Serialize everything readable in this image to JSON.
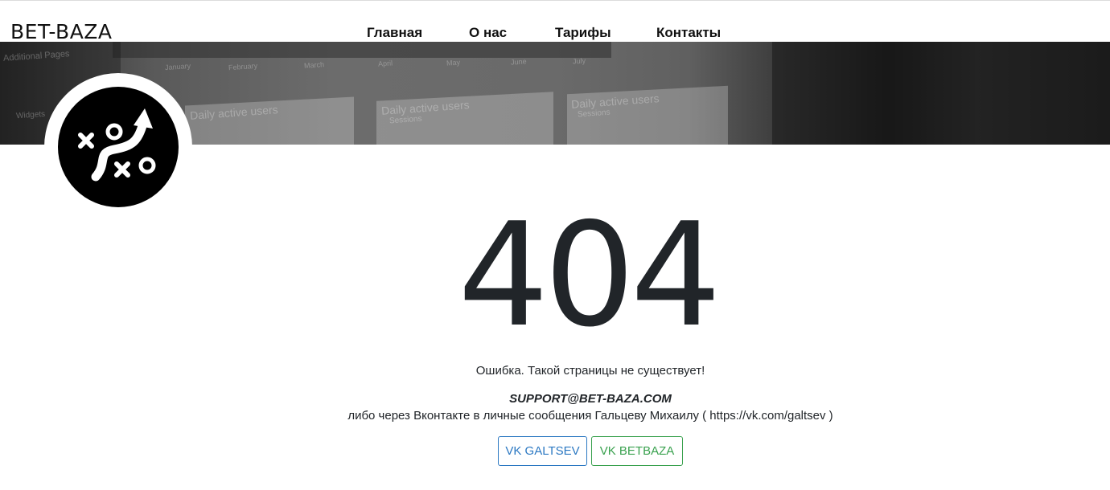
{
  "header": {
    "brand": "BET-BAZA",
    "nav": [
      {
        "label": "Главная"
      },
      {
        "label": "О нас"
      },
      {
        "label": "Тарифы"
      },
      {
        "label": "Контакты"
      }
    ]
  },
  "banner": {
    "texts": [
      "Additional Pages",
      "January",
      "February",
      "March",
      "April",
      "May",
      "June",
      "July",
      "Daily active users",
      "Daily active users",
      "Daily active users",
      "Sessions",
      "Sessions",
      "Widgets"
    ]
  },
  "logo": {
    "icon": "strategy-play-icon",
    "colors": {
      "background": "#000000",
      "foreground": "#ffffff"
    }
  },
  "error": {
    "code": "404",
    "message": "Ошибка. Такой страницы не существует!",
    "email": "SUPPORT@BET-BAZA.COM",
    "vk_note": "либо через Вконтакте в личные сообщения Гальцеву Михаилу ( https://vk.com/galtsev )"
  },
  "buttons": {
    "vk_galtsev": "VK GALTSEV",
    "vk_betbaza": "VK BETBAZA"
  },
  "colors": {
    "text": "#212529",
    "button_blue": "#2b78c2",
    "button_green": "#39a14e"
  }
}
